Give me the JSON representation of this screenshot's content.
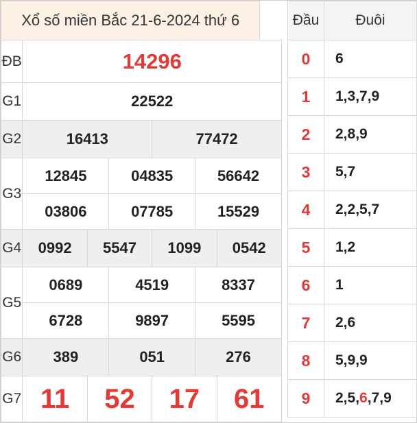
{
  "title": "Xổ số miền Bắc 21-6-2024 thứ 6",
  "prizes": {
    "db": {
      "label": "ĐB",
      "numbers": [
        "14296"
      ]
    },
    "g1": {
      "label": "G1",
      "numbers": [
        "22522"
      ]
    },
    "g2": {
      "label": "G2",
      "numbers": [
        "16413",
        "77472"
      ]
    },
    "g3": {
      "label": "G3",
      "numbers": [
        "12845",
        "04835",
        "56642",
        "03806",
        "07785",
        "15529"
      ]
    },
    "g4": {
      "label": "G4",
      "numbers": [
        "0992",
        "5547",
        "1099",
        "0542"
      ]
    },
    "g5": {
      "label": "G5",
      "numbers": [
        "0689",
        "4519",
        "8337",
        "6728",
        "9897",
        "5595"
      ]
    },
    "g6": {
      "label": "G6",
      "numbers": [
        "389",
        "051",
        "276"
      ]
    },
    "g7": {
      "label": "G7",
      "numbers": [
        "11",
        "52",
        "17",
        "61"
      ]
    }
  },
  "loto": {
    "head_label": "Đầu",
    "tail_label": "Đuôi",
    "rows": [
      {
        "head": "0",
        "tails": "6"
      },
      {
        "head": "1",
        "tails": "1,3,7,9"
      },
      {
        "head": "2",
        "tails": "2,8,9"
      },
      {
        "head": "3",
        "tails": "5,7"
      },
      {
        "head": "4",
        "tails": "2,2,5,7"
      },
      {
        "head": "5",
        "tails": "1,2"
      },
      {
        "head": "6",
        "tails": "1"
      },
      {
        "head": "7",
        "tails": "2,6"
      },
      {
        "head": "8",
        "tails": "5,9,9"
      },
      {
        "head": "9",
        "tails_before": "2,5,",
        "tails_highlight": "6",
        "tails_after": ",7,9"
      }
    ]
  },
  "colors": {
    "accent_red": "#e53935",
    "title_bg": "#fdf1e6",
    "shade_bg": "#efefef"
  }
}
